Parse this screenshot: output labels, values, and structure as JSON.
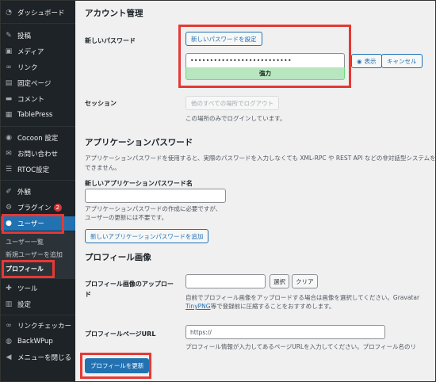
{
  "sidebar": {
    "items": [
      {
        "label": "ダッシュボード",
        "icon": "dashboard-icon"
      },
      {
        "label": "投稿",
        "icon": "pin-icon"
      },
      {
        "label": "メディア",
        "icon": "media-icon"
      },
      {
        "label": "リンク",
        "icon": "link-icon"
      },
      {
        "label": "固定ページ",
        "icon": "page-icon"
      },
      {
        "label": "コメント",
        "icon": "comment-icon"
      },
      {
        "label": "TablePress",
        "icon": "table-icon"
      },
      {
        "label": "Cocoon 設定",
        "icon": "cocoon-icon"
      },
      {
        "label": "お問い合わせ",
        "icon": "mail-icon"
      },
      {
        "label": "RTOC設定",
        "icon": "list-icon"
      },
      {
        "label": "外観",
        "icon": "brush-icon"
      },
      {
        "label": "プラグイン",
        "icon": "plugin-icon",
        "badge": "2"
      },
      {
        "label": "ユーザー",
        "icon": "user-icon"
      },
      {
        "label": "ツール",
        "icon": "wrench-icon"
      },
      {
        "label": "設定",
        "icon": "settings-icon"
      },
      {
        "label": "リンクチェッカー",
        "icon": "link-checker-icon"
      },
      {
        "label": "BackWPup",
        "icon": "backwpup-icon"
      },
      {
        "label": "メニューを閉じる",
        "icon": "collapse-icon"
      }
    ],
    "user_submenu": [
      {
        "label": "ユーザー一覧"
      },
      {
        "label": "新規ユーザーを追加"
      },
      {
        "label": "プロフィール"
      }
    ]
  },
  "account": {
    "heading": "アカウント管理",
    "new_password_label": "新しいパスワード",
    "set_password_button": "新しいパスワードを設定",
    "password_value": "••••••••••••••••••••••••••",
    "strength": "強力",
    "show_button": "表示",
    "cancel_button": "キャンセル",
    "session_label": "セッション",
    "logout_everywhere_button": "他のすべての場所でログアウト",
    "session_desc": "この場所のみでログインしています。"
  },
  "app_passwords": {
    "heading": "アプリケーションパスワード",
    "desc1": "アプリケーションパスワードを使用すると、実際のパスワードを入力しなくても XML-RPC や REST API などの非対話型システムを介",
    "desc2": "できません。",
    "name_label": "新しいアプリケーションパスワード名",
    "name_value": "",
    "help1": "アプリケーションパスワードの作成に必要ですが、",
    "help2": "ユーザーの更新には不要です。",
    "add_button": "新しいアプリケーションパスワードを追加"
  },
  "profile_image": {
    "heading": "プロフィール画像",
    "upload_label_1": "プロフィール画像のアップロー",
    "upload_label_2": "ド",
    "select_button": "選択",
    "clear_button": "クリア",
    "desc1": "自前でプロフィール画像をアップロードする場合は画像を選択してください。Gravatar",
    "desc2_link": "TinyPNG",
    "desc2_rest": "等で登録前に圧縮することをおすすめします。"
  },
  "profile_page": {
    "label": "プロフィールページURL",
    "placeholder": "https://",
    "desc": "プロフィール情報が入力してあるページURLを入力してください。プロフィール名のリ"
  },
  "update_button": "プロフィールを更新",
  "colors": {
    "sidebar_bg": "#1d2327",
    "accent": "#2271b1",
    "highlight_red": "#e53935",
    "strength_green": "#b8e6bf"
  }
}
